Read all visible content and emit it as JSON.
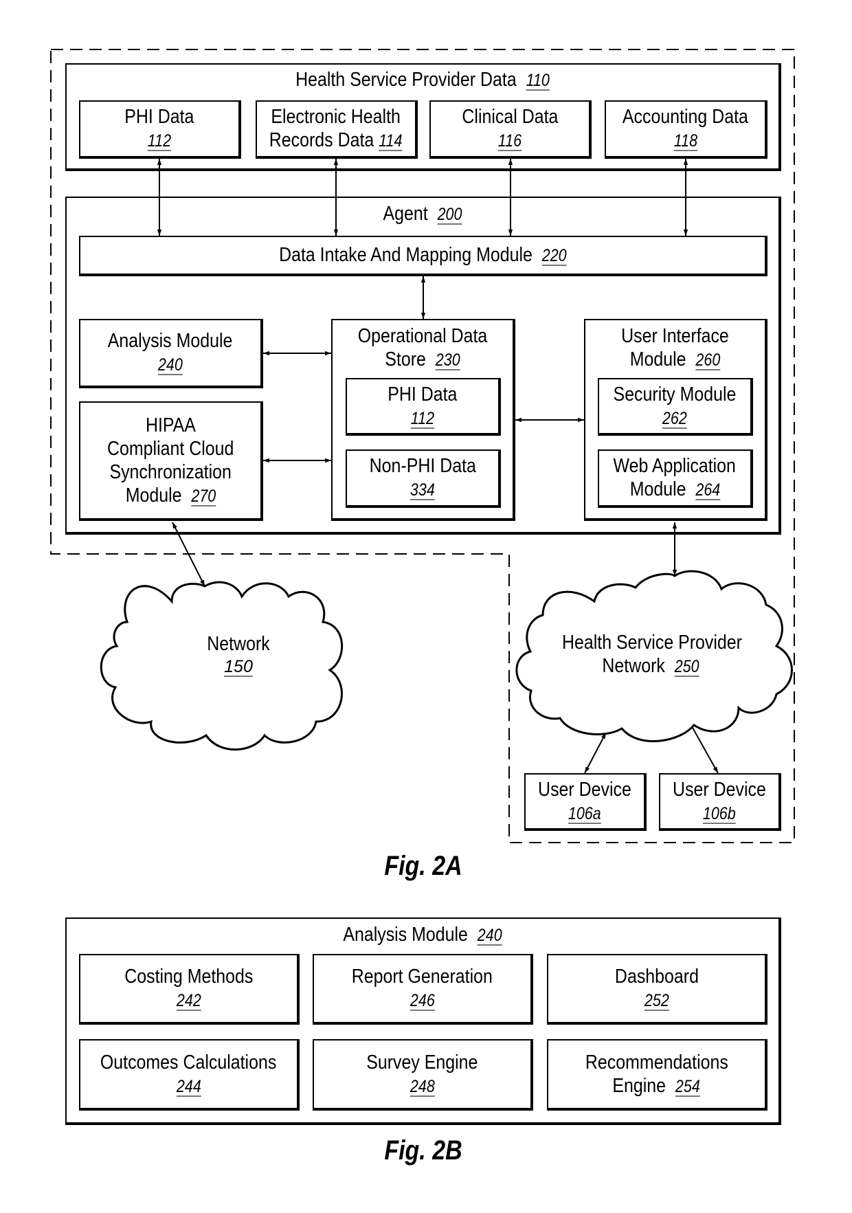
{
  "fig2a": {
    "caption": "Fig. 2A",
    "health_service_provider_data": {
      "title": "Health Service Provider Data",
      "ref": "110",
      "items": [
        {
          "lines": [
            "PHI Data"
          ],
          "ref": "112"
        },
        {
          "lines": [
            "Electronic Health",
            "Records Data"
          ],
          "ref": "114",
          "ref_inline": true
        },
        {
          "lines": [
            "Clinical Data"
          ],
          "ref": "116"
        },
        {
          "lines": [
            "Accounting Data"
          ],
          "ref": "118"
        }
      ]
    },
    "agent": {
      "title": "Agent",
      "ref": "200",
      "data_intake": {
        "title": "Data Intake And Mapping Module",
        "ref": "220"
      },
      "analysis_module": {
        "title": "Analysis Module",
        "ref": "240"
      },
      "hipaa_module": {
        "lines": [
          "HIPAA",
          "Compliant Cloud",
          "Synchronization",
          "Module"
        ],
        "ref": "270"
      },
      "operational_data_store": {
        "lines": [
          "Operational Data",
          "Store"
        ],
        "ref": "230",
        "phi": {
          "title": "PHI Data",
          "ref": "112"
        },
        "non_phi": {
          "title": "Non-PHI Data",
          "ref": "334"
        }
      },
      "user_interface_module": {
        "lines": [
          "User Interface",
          "Module"
        ],
        "ref": "260",
        "security": {
          "title": "Security Module",
          "ref": "262"
        },
        "web_app": {
          "lines": [
            "Web Application",
            "Module"
          ],
          "ref": "264"
        }
      }
    },
    "network": {
      "title": "Network",
      "ref": "150"
    },
    "hsp_network": {
      "lines": [
        "Health Service Provider",
        "Network"
      ],
      "ref": "250"
    },
    "user_devices": [
      {
        "title": "User Device",
        "ref": "106a"
      },
      {
        "title": "User Device",
        "ref": "106b"
      }
    ]
  },
  "fig2b": {
    "caption": "Fig. 2B",
    "title": "Analysis Module",
    "ref": "240",
    "cells": [
      {
        "lines": [
          "Costing Methods"
        ],
        "ref": "242"
      },
      {
        "lines": [
          "Report Generation"
        ],
        "ref": "246"
      },
      {
        "lines": [
          "Dashboard"
        ],
        "ref": "252"
      },
      {
        "lines": [
          "Outcomes Calculations"
        ],
        "ref": "244"
      },
      {
        "lines": [
          "Survey Engine"
        ],
        "ref": "248"
      },
      {
        "lines": [
          "Recommendations",
          "Engine"
        ],
        "ref": "254",
        "ref_inline": true
      }
    ]
  }
}
